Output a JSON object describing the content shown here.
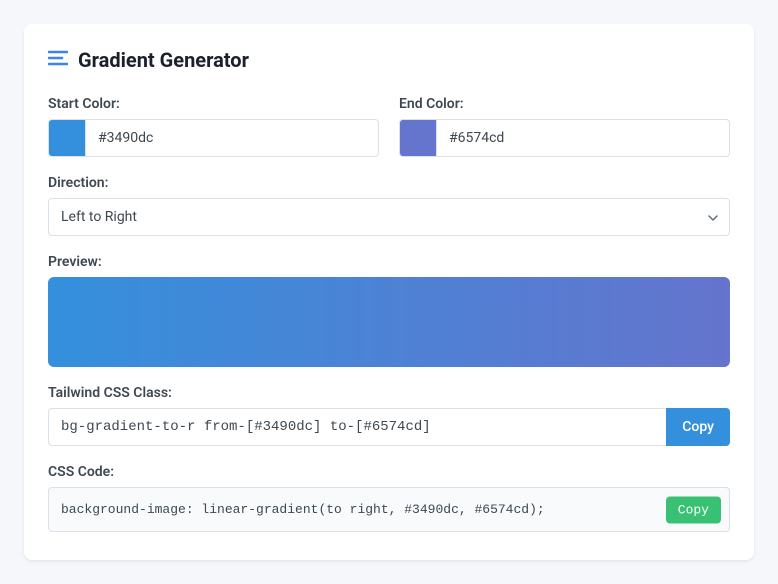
{
  "header": {
    "title": "Gradient Generator"
  },
  "startColor": {
    "label": "Start Color:",
    "value": "#3490dc",
    "swatch": "#3490dc"
  },
  "endColor": {
    "label": "End Color:",
    "value": "#6574cd",
    "swatch": "#6574cd"
  },
  "direction": {
    "label": "Direction:",
    "selected": "Left to Right"
  },
  "preview": {
    "label": "Preview:"
  },
  "tailwind": {
    "label": "Tailwind CSS Class:",
    "value": "bg-gradient-to-r from-[#3490dc] to-[#6574cd]",
    "copy": "Copy"
  },
  "css": {
    "label": "CSS Code:",
    "value": "background-image: linear-gradient(to right, #3490dc, #6574cd);",
    "copy": "Copy"
  }
}
